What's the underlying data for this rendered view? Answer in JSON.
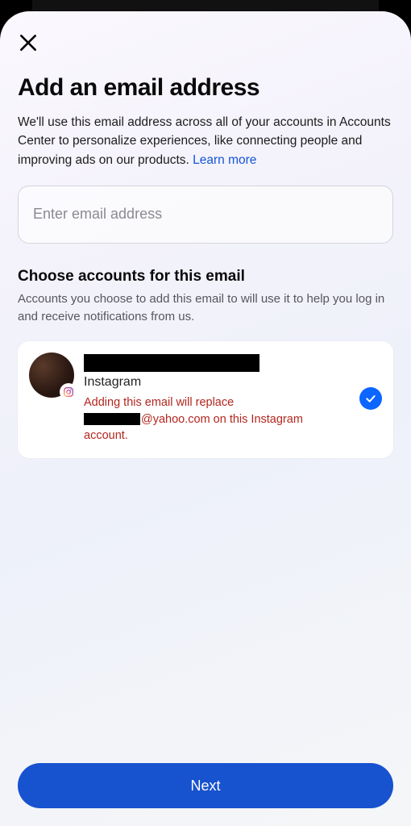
{
  "header": {
    "title": "Add an email address",
    "subtitle": "We'll use this email address across all of your accounts in Accounts Center to personalize experiences, like connecting people and improving ads on our products. ",
    "learn_more": "Learn more"
  },
  "email_input": {
    "placeholder": "Enter email address",
    "value": ""
  },
  "choose_section": {
    "heading": "Choose accounts for this email",
    "sub": "Accounts you choose to add this email to will use it to help you log in and receive notifications from us."
  },
  "account": {
    "platform": "Instagram",
    "warning_prefix": "Adding this email will replace ",
    "warning_suffix": "@yahoo.com on this Instagram account.",
    "selected": true
  },
  "footer": {
    "next": "Next"
  }
}
